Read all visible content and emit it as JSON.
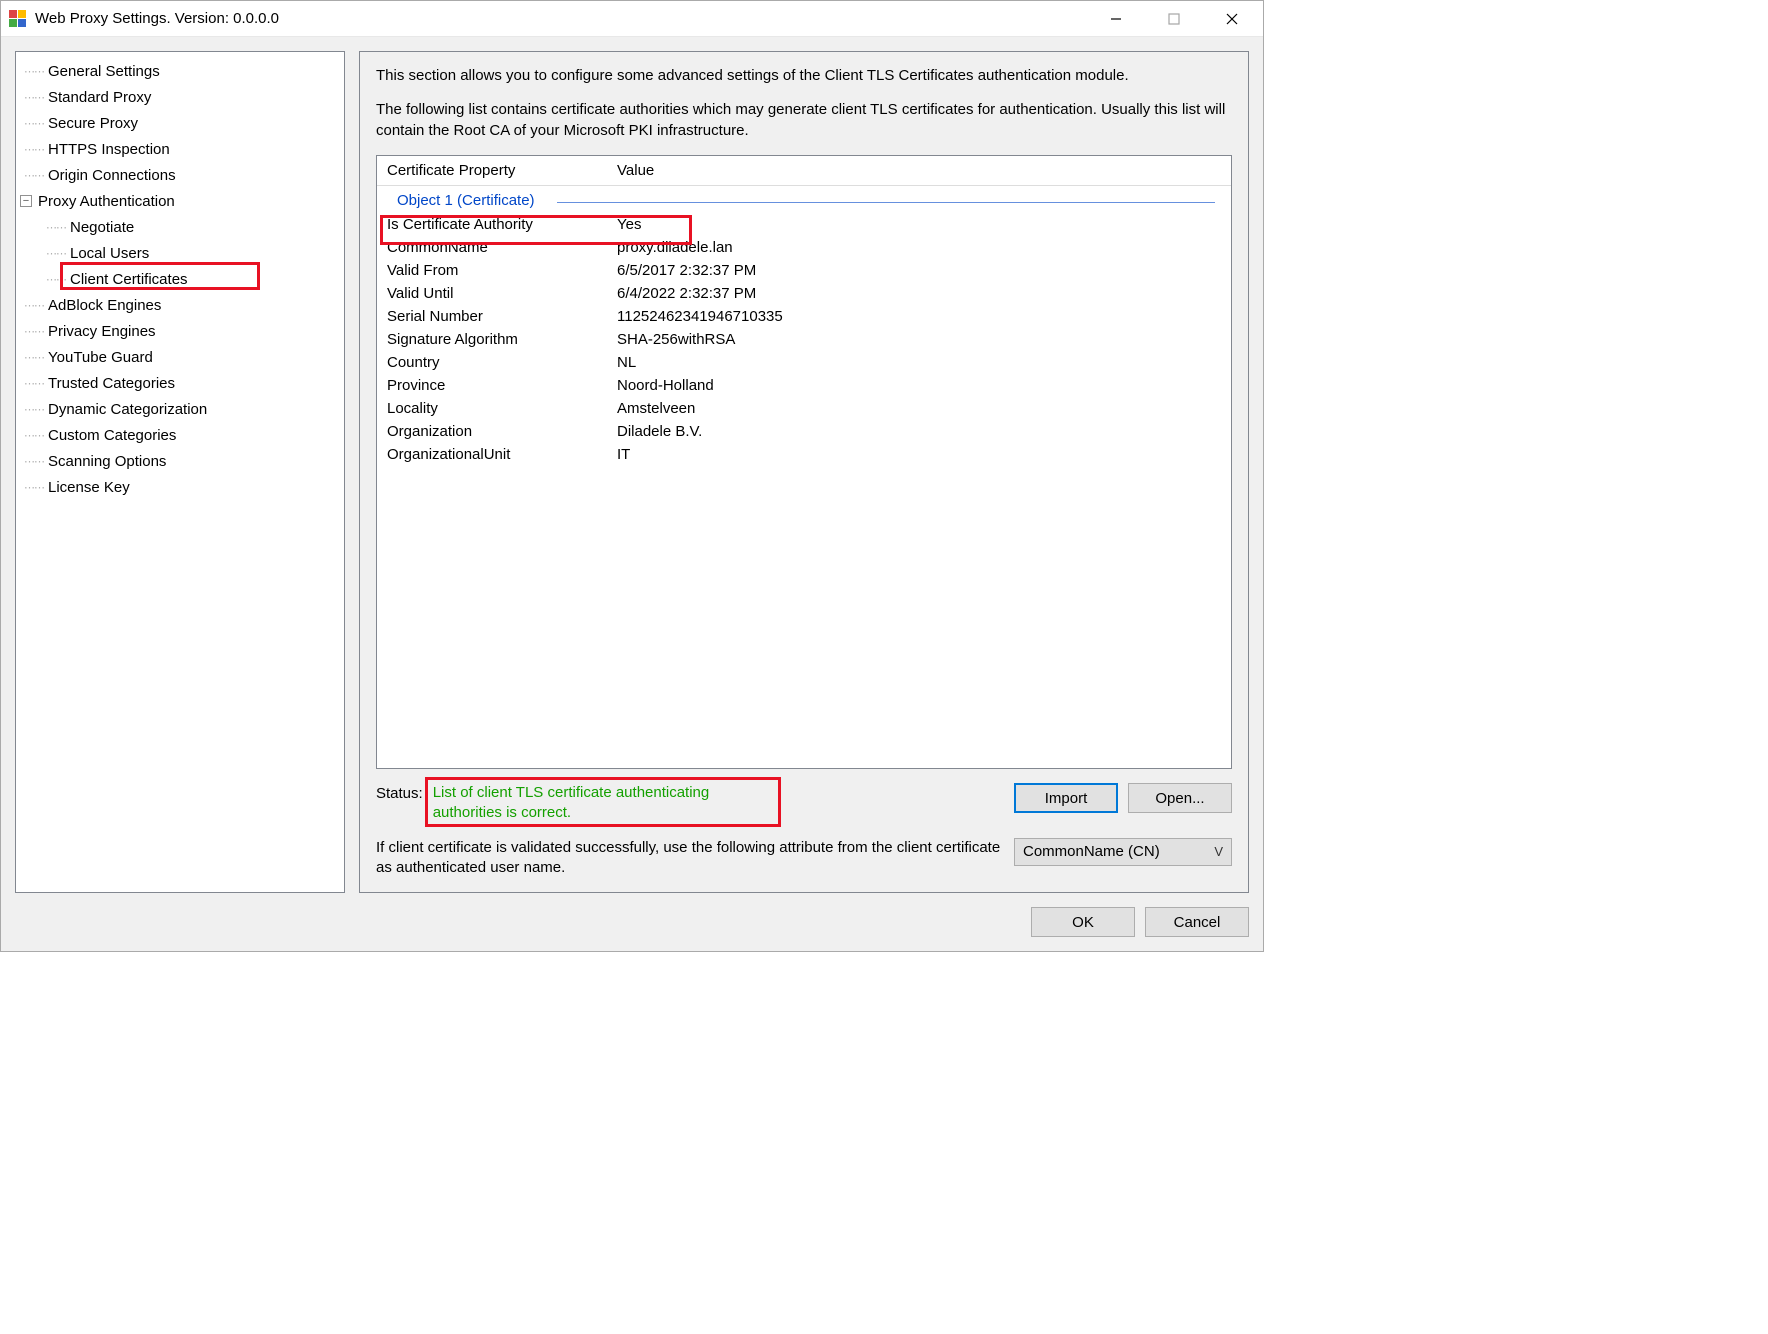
{
  "window": {
    "title": "Web Proxy Settings. Version: 0.0.0.0"
  },
  "sidebar": {
    "items": [
      "General Settings",
      "Standard Proxy",
      "Secure Proxy",
      "HTTPS Inspection",
      "Origin Connections",
      "Proxy Authentication",
      "AdBlock Engines",
      "Privacy Engines",
      "YouTube Guard",
      "Trusted Categories",
      "Dynamic Categorization",
      "Custom Categories",
      "Scanning Options",
      "License Key"
    ],
    "auth_children": [
      "Negotiate",
      "Local Users",
      "Client Certificates"
    ]
  },
  "main": {
    "intro1": "This section allows you to configure some advanced settings of the Client TLS Certificates authentication module.",
    "intro2": "The following list contains certificate authorities which may generate client TLS certificates for authentication. Usually this list will contain the Root CA of your Microsoft PKI infrastructure.",
    "headers": {
      "prop": "Certificate Property",
      "val": "Value"
    },
    "group": "Object 1 (Certificate)",
    "rows": [
      {
        "prop": "Is Certificate Authority",
        "val": "Yes"
      },
      {
        "prop": "CommonName",
        "val": "proxy.diladele.lan"
      },
      {
        "prop": "Valid From",
        "val": "6/5/2017 2:32:37 PM"
      },
      {
        "prop": "Valid Until",
        "val": "6/4/2022 2:32:37 PM"
      },
      {
        "prop": "Serial Number",
        "val": "11252462341946710335"
      },
      {
        "prop": "Signature Algorithm",
        "val": "SHA-256withRSA"
      },
      {
        "prop": "Country",
        "val": "NL"
      },
      {
        "prop": "Province",
        "val": "Noord-Holland"
      },
      {
        "prop": "Locality",
        "val": "Amstelveen"
      },
      {
        "prop": "Organization",
        "val": "Diladele B.V."
      },
      {
        "prop": "OrganizationalUnit",
        "val": "IT"
      }
    ],
    "status_label": "Status:",
    "status_msg": "List of client TLS certificate authenticating authorities is correct.",
    "import_btn": "Import",
    "open_btn": "Open...",
    "below_text": "If client certificate is validated successfully, use the following attribute from the client certificate as authenticated user name.",
    "select_value": "CommonName (CN)"
  },
  "dialog": {
    "ok": "OK",
    "cancel": "Cancel"
  }
}
